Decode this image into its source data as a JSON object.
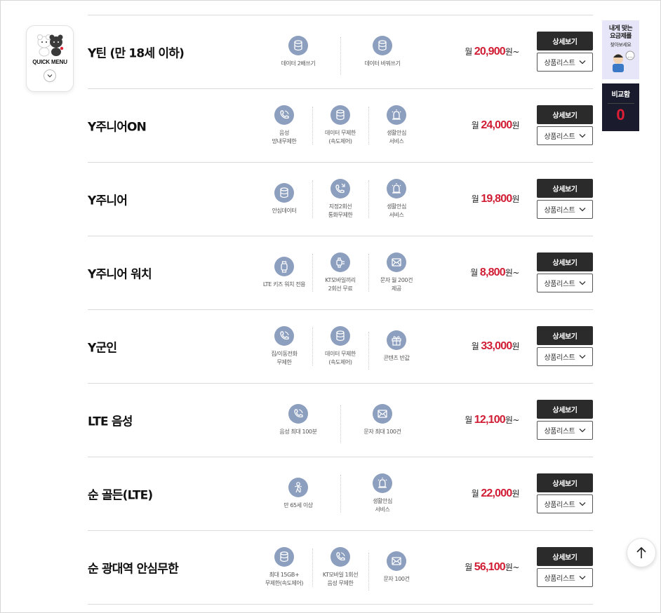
{
  "quick_menu": {
    "label": "QUICK MENU"
  },
  "plans": [
    {
      "name": "Y틴 (만 18세 이하)",
      "features": [
        {
          "icon": "database-icon",
          "text": "데이터 2배쓰기"
        },
        {
          "icon": "database-icon",
          "text": "데이터 바꿔쓰기"
        }
      ],
      "price_prefix": "월",
      "price": "20,900",
      "price_suffix": "원~"
    },
    {
      "name": "Y주니어ON",
      "features": [
        {
          "icon": "phone-icon",
          "text": "음성\n망내무제한"
        },
        {
          "icon": "database-icon",
          "text": "데이터 무제한\n(속도제어)"
        },
        {
          "icon": "alarm-icon",
          "text": "생활안심\n서비스"
        }
      ],
      "price_prefix": "월",
      "price": "24,000",
      "price_suffix": "원"
    },
    {
      "name": "Y주니어",
      "features": [
        {
          "icon": "database-icon",
          "text": "안심데이터"
        },
        {
          "icon": "phone-call-icon",
          "text": "지정2회선\n통화무제한"
        },
        {
          "icon": "alarm-icon",
          "text": "생활안심\n서비스"
        }
      ],
      "price_prefix": "월",
      "price": "19,800",
      "price_suffix": "원"
    },
    {
      "name": "Y주니어 워치",
      "features": [
        {
          "icon": "watch-icon",
          "text": "LTE 키즈 워치 전용"
        },
        {
          "icon": "watch-call-icon",
          "text": "KT모바일끼리\n2회선 무료"
        },
        {
          "icon": "mail-icon",
          "text": "문자 월 200건\n제공"
        }
      ],
      "price_prefix": "월",
      "price": "8,800",
      "price_suffix": "원~"
    },
    {
      "name": "Y군인",
      "features": [
        {
          "icon": "phone-icon",
          "text": "집/이동전화\n무제한"
        },
        {
          "icon": "database-icon",
          "text": "데이터 무제한\n(속도제어)"
        },
        {
          "icon": "gift-icon",
          "text": "콘텐츠 반값"
        }
      ],
      "price_prefix": "월",
      "price": "33,000",
      "price_suffix": "원"
    },
    {
      "name": "LTE 음성",
      "features": [
        {
          "icon": "phone-icon",
          "text": "음성 최대 100분"
        },
        {
          "icon": "mail-icon",
          "text": "문자 최대 100건"
        }
      ],
      "price_prefix": "월",
      "price": "12,100",
      "price_suffix": "원~"
    },
    {
      "name": "순 골든(LTE)",
      "features": [
        {
          "icon": "senior-icon",
          "text": "만 65세 이상"
        },
        {
          "icon": "alarm-icon",
          "text": "생활안심\n서비스"
        }
      ],
      "price_prefix": "월",
      "price": "22,000",
      "price_suffix": "원"
    },
    {
      "name": "순 광대역 안심무한",
      "features": [
        {
          "icon": "database-icon",
          "text": "최대 15GB+\n무제한(속도제어)"
        },
        {
          "icon": "phone-icon",
          "text": "KT모바일 1회선\n음성 무제한"
        },
        {
          "icon": "mail-icon",
          "text": "문자 100건"
        }
      ],
      "price_prefix": "월",
      "price": "56,100",
      "price_suffix": "원~"
    }
  ],
  "buttons": {
    "detail": "상세보기",
    "list": "상품리스트"
  },
  "sidebar": {
    "promo_title": "내게 맞는\n요금제를",
    "promo_sub": "찾아보세요",
    "compare_label": "비교함",
    "compare_count": "0"
  },
  "colors": {
    "price": "#d11d34",
    "icon_bg": "#8d9fbf",
    "button_dark": "#2b2b2b"
  }
}
